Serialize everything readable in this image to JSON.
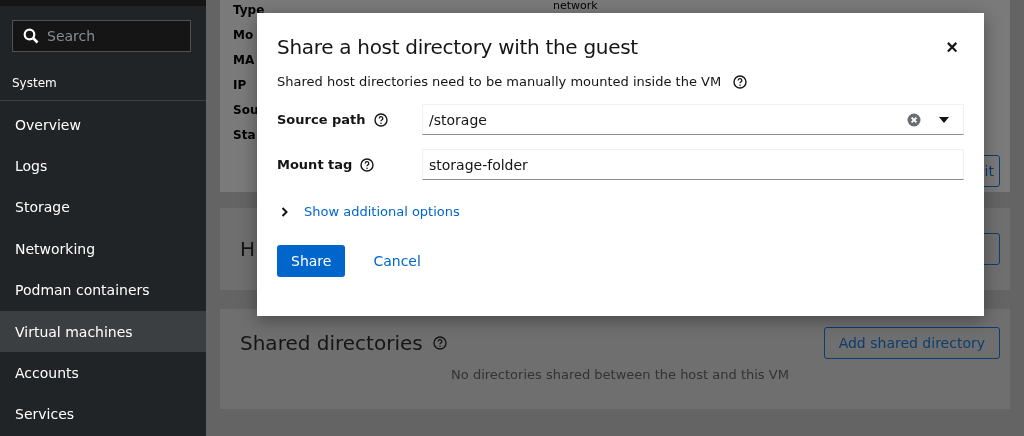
{
  "sidebar": {
    "search": {
      "placeholder": "Search"
    },
    "section": "System",
    "items": [
      {
        "label": "Overview",
        "selected": false
      },
      {
        "label": "Logs",
        "selected": false
      },
      {
        "label": "Storage",
        "selected": false
      },
      {
        "label": "Networking",
        "selected": false
      },
      {
        "label": "Podman containers",
        "selected": false
      },
      {
        "label": "Virtual machines",
        "selected": true
      },
      {
        "label": "Accounts",
        "selected": false
      },
      {
        "label": "Services",
        "selected": false
      }
    ]
  },
  "background": {
    "details_labels": [
      "Type",
      "Mo",
      "MA",
      "IP",
      "Sou",
      "Sta"
    ],
    "details_value": "network",
    "edit_button": "it",
    "card2_heading": "H",
    "shared": {
      "title": "Shared directories",
      "button": "Add shared directory",
      "empty": "No directories shared between the host and this VM"
    }
  },
  "dialog": {
    "title": "Share a host directory with the guest",
    "close": "×",
    "description": "Shared host directories need to be manually mounted inside the VM",
    "fields": [
      {
        "label": "Source path",
        "kind": "select",
        "value": "/storage"
      },
      {
        "label": "Mount tag",
        "kind": "text",
        "value": "storage-folder"
      }
    ],
    "expander": {
      "label": "Show additional options",
      "expanded": false
    },
    "buttons": [
      {
        "label": "Share",
        "kind": "primary"
      },
      {
        "label": "Cancel",
        "kind": "link"
      }
    ]
  }
}
